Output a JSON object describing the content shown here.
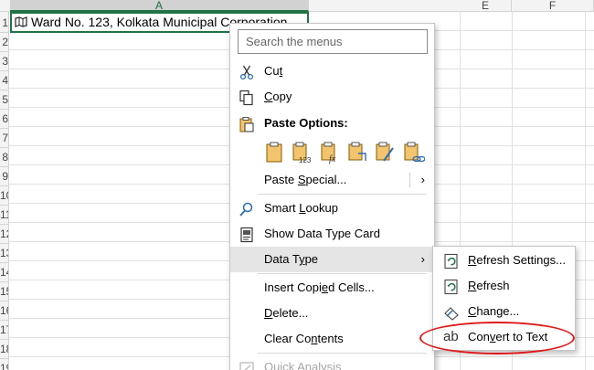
{
  "columns": [
    {
      "label": "A",
      "selected": true
    },
    {
      "label": "E",
      "selected": false
    },
    {
      "label": "F",
      "selected": false
    }
  ],
  "rows": [
    "1",
    "2",
    "3",
    "4",
    "5",
    "6",
    "7",
    "8",
    "9",
    "10",
    "11",
    "12",
    "13",
    "14",
    "15",
    "16",
    "17",
    "18",
    "19"
  ],
  "cell_a1": {
    "value": "Ward No. 123, Kolkata Municipal Corporation",
    "data_type_icon": "map-icon"
  },
  "context_menu": {
    "search_placeholder": "Search the menus",
    "cut": {
      "pre": "Cu",
      "accel": "t",
      "post": "",
      "icon": "scissors-icon"
    },
    "copy": {
      "pre": "",
      "accel": "C",
      "post": "opy",
      "icon": "copy-icon"
    },
    "paste_options": {
      "label": "Paste Options:",
      "icon": "clipboard-icon"
    },
    "paste_buttons": [
      "paste-icon",
      "paste-values-icon",
      "paste-formulas-icon",
      "paste-transpose-icon",
      "paste-formatting-icon",
      "paste-link-icon"
    ],
    "paste_special": {
      "pre": "Paste ",
      "accel": "S",
      "post": "pecial..."
    },
    "smart_lookup": {
      "pre": "Smart ",
      "accel": "L",
      "post": "ookup",
      "icon": "search-icon"
    },
    "show_data_type_card": {
      "label": "Show Data Type Card",
      "icon": "card-icon"
    },
    "data_type": {
      "pre": "Data T",
      "accel": "y",
      "post": "pe"
    },
    "insert_copied_cells": {
      "pre": "Insert Copi",
      "accel": "e",
      "post": "d Cells..."
    },
    "delete": {
      "pre": "",
      "accel": "D",
      "post": "elete..."
    },
    "clear_contents": {
      "pre": "Clear Co",
      "accel": "n",
      "post": "tents"
    },
    "quick_analysis": {
      "pre": "",
      "accel": "Q",
      "post": "uick Analysis"
    }
  },
  "submenu": {
    "refresh_settings": {
      "pre": "",
      "accel": "R",
      "post": "efresh Settings...",
      "icon": "refresh-icon"
    },
    "refresh": {
      "pre": "",
      "accel": "R",
      "post": "efresh",
      "icon": "refresh-icon"
    },
    "change": {
      "pre": "",
      "accel": "C",
      "post": "hange...",
      "icon": "change-icon"
    },
    "convert_to_text": {
      "icon_text": "ab",
      "pre": "Con",
      "accel": "v",
      "post": "ert to Text"
    }
  },
  "colors": {
    "accent": "#217346",
    "highlight_circle": "#e01b1b",
    "hover": "#e5e5e5"
  }
}
